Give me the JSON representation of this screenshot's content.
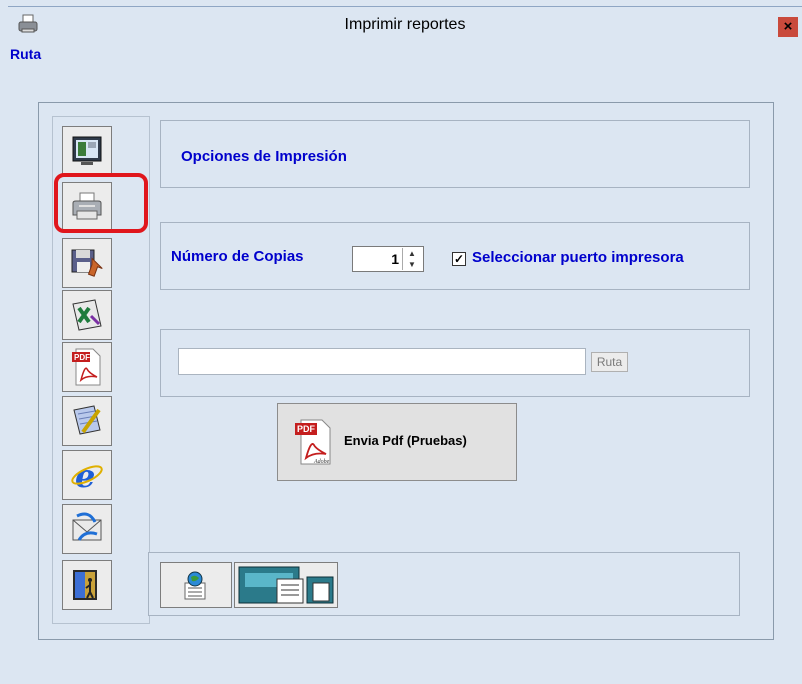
{
  "window": {
    "title": "Imprimir reportes",
    "close_label": "×"
  },
  "path_label": "Ruta",
  "toolbar": {
    "buttons": [
      {
        "name": "preview-screen-icon"
      },
      {
        "name": "printer-icon",
        "selected": true
      },
      {
        "name": "save-disk-icon"
      },
      {
        "name": "excel-icon"
      },
      {
        "name": "pdf-icon"
      },
      {
        "name": "notepad-icon"
      },
      {
        "name": "internet-explorer-icon"
      },
      {
        "name": "email-send-icon"
      },
      {
        "name": "exit-door-icon"
      }
    ],
    "highlight_color": "#e0161c"
  },
  "print_options": {
    "heading": "Opciones de Impresión"
  },
  "copies": {
    "label": "Número de Copias",
    "value": "1",
    "select_port_checked": true,
    "select_port_label": "Seleccionar puerto impresora"
  },
  "path": {
    "value": "",
    "button_label": "Ruta"
  },
  "send_pdf": {
    "label": "Envia Pdf (Pruebas)",
    "pdf_badge": "PDF",
    "adobe_text": "Adobe"
  },
  "bottom_buttons": [
    {
      "name": "web-document-icon"
    },
    {
      "name": "document-stack-icon"
    }
  ],
  "colors": {
    "accent_text": "#0000cc",
    "background": "#dce6f2"
  }
}
